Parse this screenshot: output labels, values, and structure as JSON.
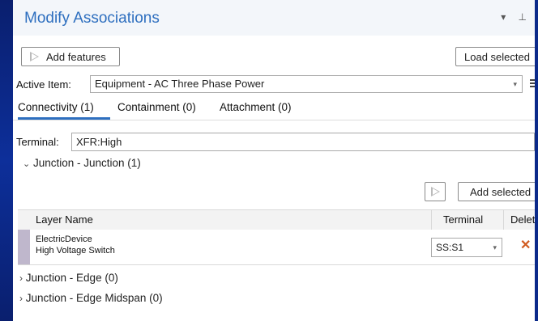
{
  "pane": {
    "title": "Modify Associations",
    "controls": "▾ ⊥"
  },
  "toolbar": {
    "add_features_label": "Add features",
    "load_selected_label": "Load selected"
  },
  "active_item": {
    "label": "Active Item:",
    "value": "Equipment - AC Three Phase Power"
  },
  "tabs": [
    {
      "label": "Connectivity (1)",
      "selected": true
    },
    {
      "label": "Containment (0)",
      "selected": false
    },
    {
      "label": "Attachment (0)",
      "selected": false
    }
  ],
  "terminal": {
    "label": "Terminal:",
    "value": "XFR:High"
  },
  "sections": {
    "junction_junction": "Junction - Junction (1)",
    "junction_edge": "Junction - Edge (0)",
    "junction_edge_midspan": "Junction - Edge Midspan (0)"
  },
  "grid": {
    "add_selected_label": "Add selected",
    "columns": {
      "layer_name": "Layer Name",
      "terminal": "Terminal",
      "delete": "Delet"
    },
    "rows": [
      {
        "layer": "ElectricDevice",
        "subtype": "High Voltage Switch",
        "terminal": "SS:S1"
      }
    ]
  },
  "colors": {
    "accent": "#2e6fbf",
    "background_desktop": "#0b2a8a",
    "delete_icon": "#d05a1e",
    "row_selector": "#bfb7cc"
  }
}
